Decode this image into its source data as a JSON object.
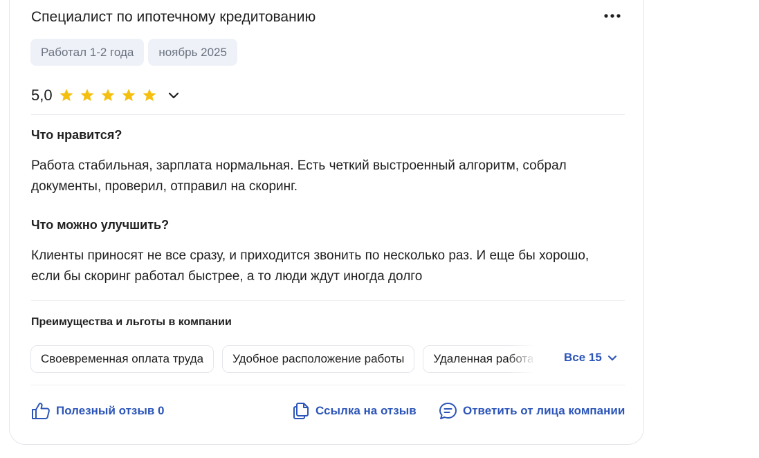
{
  "review": {
    "title": "Специалист по ипотечному кредитованию",
    "tags": [
      "Работал 1-2 года",
      "ноябрь 2025"
    ],
    "rating": {
      "value_text": "5,0",
      "value": 5,
      "max": 5,
      "star_color": "#f5bf0f"
    },
    "likes": {
      "heading": "Что нравится?",
      "text": "Работа стабильная, зарплата нормальная. Есть четкий выстроенный алгоритм, собрал документы, проверил, отправил на скоринг."
    },
    "improve": {
      "heading": "Что можно улучшить?",
      "text": "Клиенты приносят не все сразу, и приходится звонить по несколько раз. И еще бы хорошо, если бы скоринг работал быстрее, а то люди ждут иногда долго"
    },
    "benefits": {
      "title": "Преимущества и льготы в компании",
      "items": [
        "Своевременная оплата труда",
        "Удобное расположение работы",
        "Удаленная работа"
      ],
      "all_label": "Все 15"
    },
    "footer": {
      "useful_label": "Полезный отзыв 0",
      "link_label": "Ссылка на отзыв",
      "reply_label": "Ответить от лица компании"
    }
  },
  "colors": {
    "accent": "#2c55b8",
    "tag_bg": "#eef1f7",
    "tag_text": "#6b7280"
  },
  "icons": {
    "more": "more-dots-icon",
    "chevron": "chevron-down-icon",
    "star": "star-icon",
    "thumb": "thumbs-up-icon",
    "copy": "copy-link-icon",
    "chat": "chat-bubble-icon"
  }
}
